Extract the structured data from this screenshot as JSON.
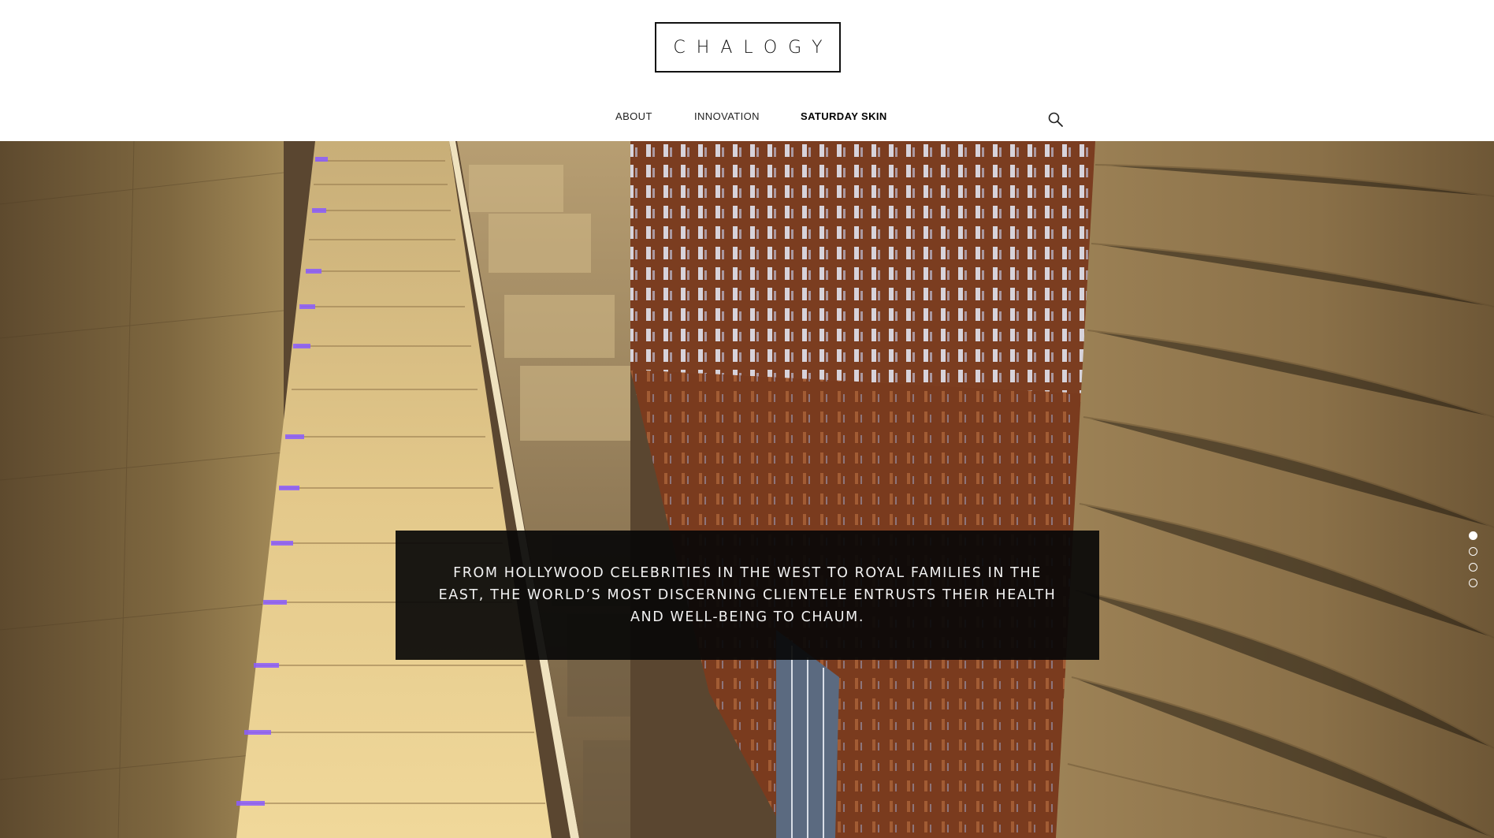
{
  "brand": {
    "logo_text": "CHALOGY"
  },
  "nav": {
    "items": [
      {
        "label": "ABOUT"
      },
      {
        "label": "INNOVATION"
      },
      {
        "label": "SATURDAY SKIN"
      }
    ],
    "search_icon": "search-icon"
  },
  "hero": {
    "quote": "FROM HOLLYWOOD CELEBRITIES IN THE WEST TO ROYAL FAMILIES IN THE EAST, THE WORLD’S MOST DISCERNING CLIENTELE ENTRUSTS THEIR HEALTH AND WELL-BEING TO CHAUM.",
    "slides_total": 4,
    "active_slide": 1
  },
  "colors": {
    "quote_bg": "#080808",
    "accent_light": "#ffffff",
    "stair_light": "#8a5cff"
  }
}
